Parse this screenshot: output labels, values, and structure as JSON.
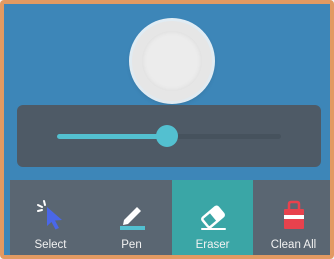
{
  "brush": {
    "size_level": 0.49,
    "accent": "#53c0d0"
  },
  "tools": [
    {
      "label": "Select",
      "icon": "cursor-icon"
    },
    {
      "label": "Pen",
      "icon": "pen-icon"
    },
    {
      "label": "Eraser",
      "icon": "eraser-icon"
    },
    {
      "label": "Clean All",
      "icon": "clean-all-icon"
    }
  ],
  "active_tool": "Eraser",
  "colors": {
    "background": "#3d86b8",
    "panel": "#4e5a66",
    "toolbar": "#5a6672",
    "active": "#3aa6a6",
    "accent": "#53c0d0",
    "cursor": "#4a67e8",
    "bucket": "#e8424d"
  }
}
